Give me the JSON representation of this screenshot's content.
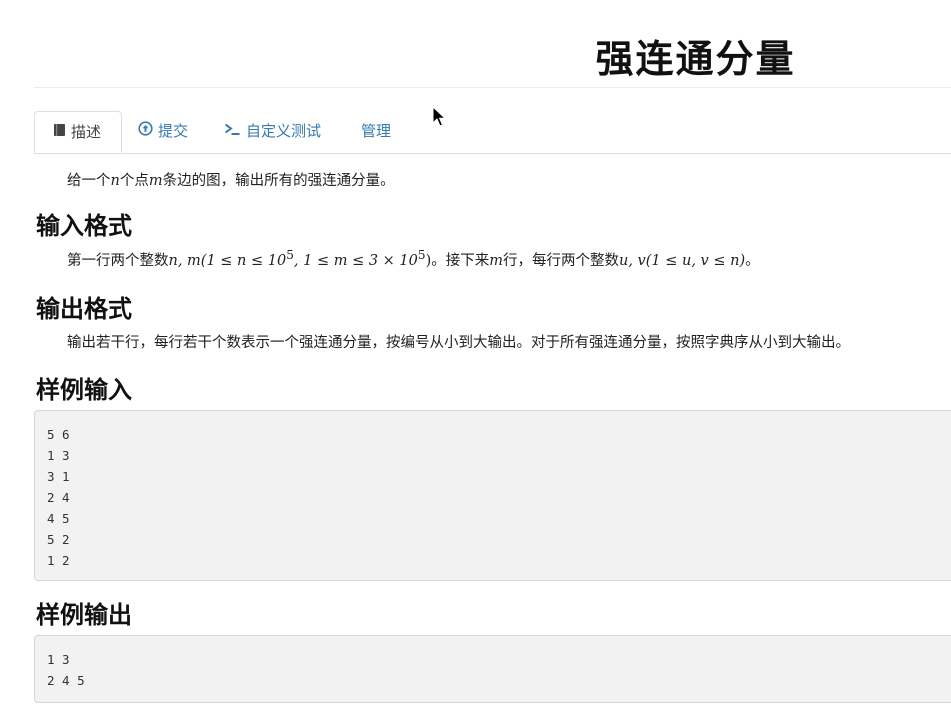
{
  "problem": {
    "title": "强连通分量"
  },
  "tabs": [
    {
      "label": "描述",
      "icon": "book-icon"
    },
    {
      "label": "提交",
      "icon": "upload-circle-icon"
    },
    {
      "label": "自定义测试",
      "icon": "terminal-icon"
    },
    {
      "label": "管理",
      "icon": ""
    }
  ],
  "description": {
    "pre": "给一个",
    "var_n": "n",
    "mid1": "个点",
    "var_m": "m",
    "post": "条边的图，输出所有的强连通分量。"
  },
  "input_format": {
    "heading": "输入格式",
    "text_a": "第一行两个整数",
    "math_a": "n, m(1 ≤ n ≤ 10",
    "sup1": "5",
    "math_b": ", 1 ≤ m ≤ 3 × 10",
    "sup2": "5",
    "math_c": ")",
    "text_b": "。接下来",
    "var_m": "m",
    "text_c": "行，每行两个整数",
    "math_d": "u, v(1 ≤ u, v ≤ n)",
    "text_d": "。"
  },
  "output_format": {
    "heading": "输出格式",
    "text": "输出若干行，每行若干个数表示一个强连通分量，按编号从小到大输出。对于所有强连通分量，按照字典序从小到大输出。"
  },
  "sample_input": {
    "heading": "样例输入",
    "lines": [
      "5 6",
      "1 3",
      "3 1",
      "2 4",
      "4 5",
      "5 2",
      "1 2"
    ]
  },
  "sample_output": {
    "heading": "样例输出",
    "lines": [
      "1 3",
      "2 4 5"
    ]
  }
}
